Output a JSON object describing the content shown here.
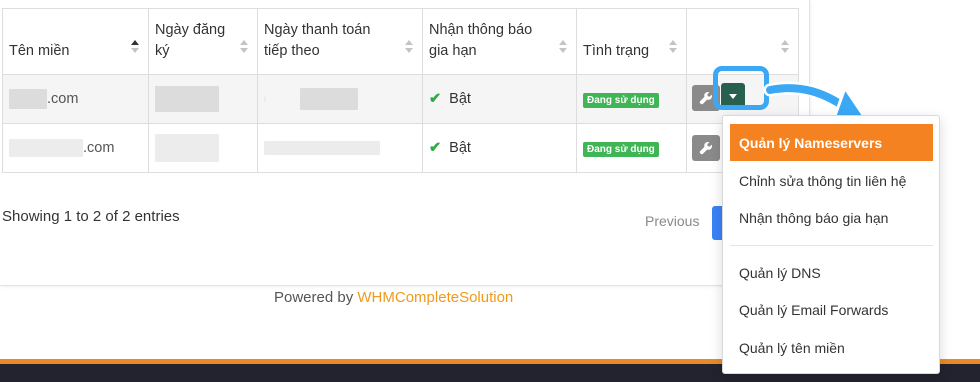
{
  "table": {
    "headers": {
      "domain": "Tên miền",
      "registered": "Ngày đăng ký",
      "next_due": "Ngày thanh toán tiếp theo",
      "renewal_notice": "Nhận thông báo gia hạn",
      "status": "Tình trạng"
    },
    "rows": [
      {
        "domain_suffix": ".com",
        "renewal": "Bật",
        "status": "Đang sử dụng"
      },
      {
        "domain_suffix": ".com",
        "renewal": "Bật",
        "status": "Đang sử dụng"
      }
    ]
  },
  "pagination": {
    "showing": "Showing 1 to 2 of 2 entries",
    "previous": "Previous"
  },
  "footer": {
    "powered_by": "Powered by ",
    "brand": "WHMCompleteSolution"
  },
  "dropdown": {
    "items": [
      "Quản lý Nameservers",
      "Chỉnh sửa thông tin liên hệ",
      "Nhận thông báo gia hạn",
      "Quản lý DNS",
      "Quản lý Email Forwards",
      "Quản lý tên miền"
    ],
    "active_index": 0
  },
  "colors": {
    "accent_orange": "#f58220",
    "brand_link": "#f09a1c",
    "status_green": "#3fb555",
    "highlight_blue": "#3ba8f5",
    "caret_button": "#27604f"
  },
  "icons": {
    "sort": "sort-arrows-icon",
    "check": "check-icon",
    "wrench": "wrench-icon",
    "caret": "caret-down-icon"
  }
}
